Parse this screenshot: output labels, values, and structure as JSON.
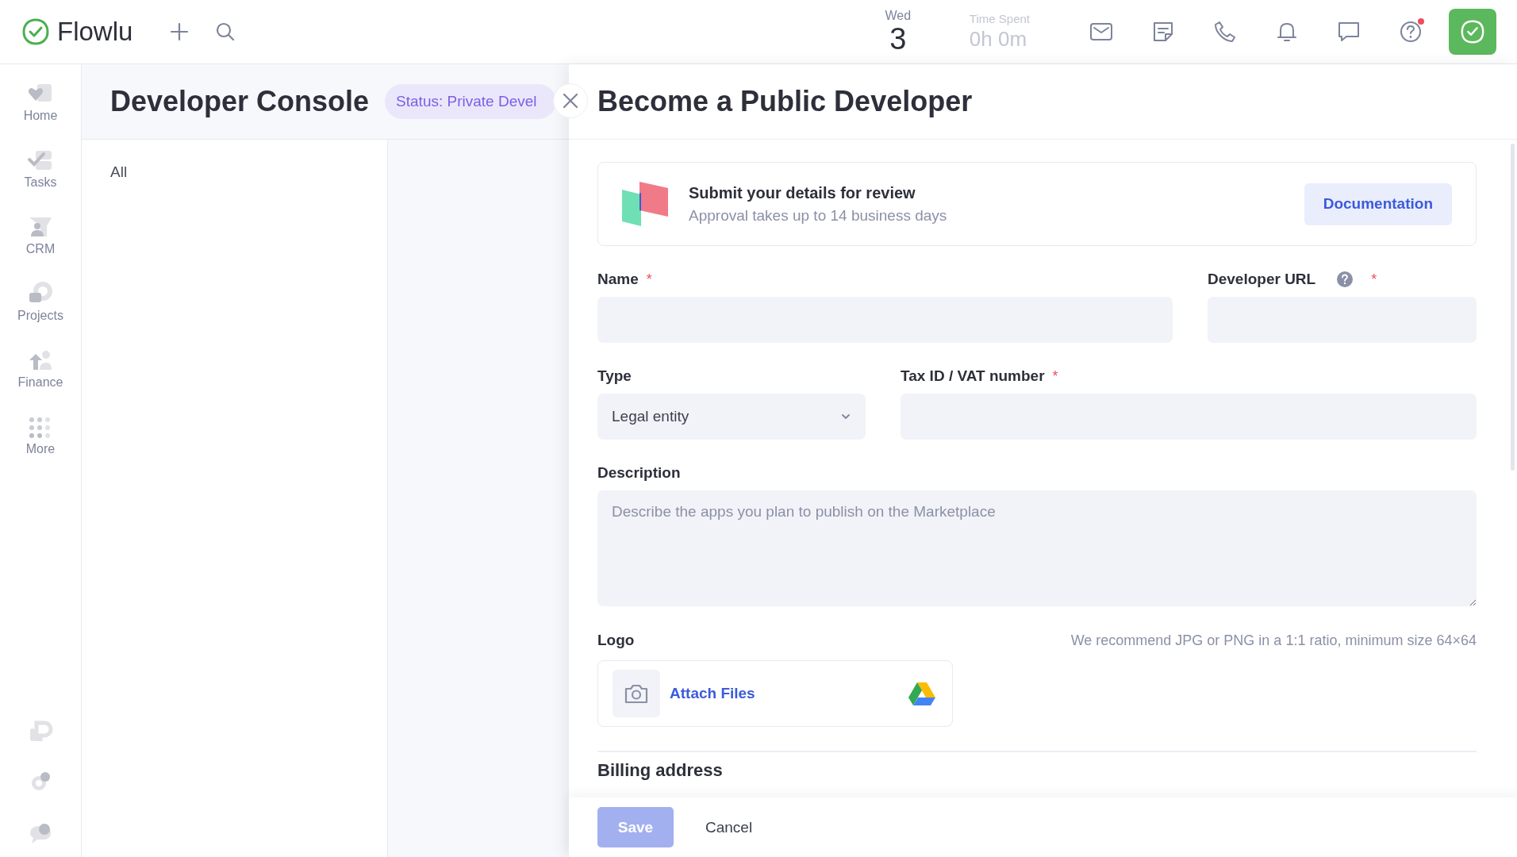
{
  "topbar": {
    "logo": "Flowlu",
    "date": {
      "weekday": "Wed",
      "day": "3"
    },
    "time_spent": {
      "label": "Time Spent",
      "value": "0h 0m"
    },
    "help_notification": true
  },
  "sidebar": {
    "items": [
      {
        "label": "Home",
        "kind": "home"
      },
      {
        "label": "Tasks",
        "kind": "tasks"
      },
      {
        "label": "CRM",
        "kind": "crm"
      },
      {
        "label": "Projects",
        "kind": "projects"
      },
      {
        "label": "Finance",
        "kind": "finance"
      },
      {
        "label": "More",
        "kind": "more"
      }
    ]
  },
  "page": {
    "title": "Developer Console",
    "status": "Status: Private Devel",
    "filters": [
      {
        "label": "All"
      }
    ]
  },
  "panel": {
    "title": "Become a Public Developer",
    "notice": {
      "title": "Submit your details for review",
      "subtitle": "Approval takes up to 14 business days",
      "button": "Documentation"
    },
    "rows": [
      [
        {
          "kind": "text",
          "label": "Name",
          "required_mark": "*",
          "help": false
        },
        {
          "kind": "text",
          "label": "Developer URL",
          "required_mark": "*",
          "help": true
        }
      ],
      [
        {
          "kind": "select",
          "label": "Type",
          "help": false,
          "value": "Legal entity"
        },
        {
          "kind": "text",
          "label": "Tax ID / VAT number",
          "required_mark": "*",
          "help": false
        }
      ],
      [
        {
          "kind": "textarea",
          "label": "Description",
          "help": false,
          "placeholder": "Describe the apps you plan to publish on the Marketplace"
        }
      ]
    ],
    "logo": {
      "label": "Logo",
      "hint": "We recommend JPG or PNG in a 1:1 ratio, minimum size 64×64",
      "attach": "Attach Files"
    },
    "section": "Billing address",
    "footer": {
      "save": {
        "label": "Save",
        "disabled": true
      },
      "cancel": "Cancel"
    }
  }
}
